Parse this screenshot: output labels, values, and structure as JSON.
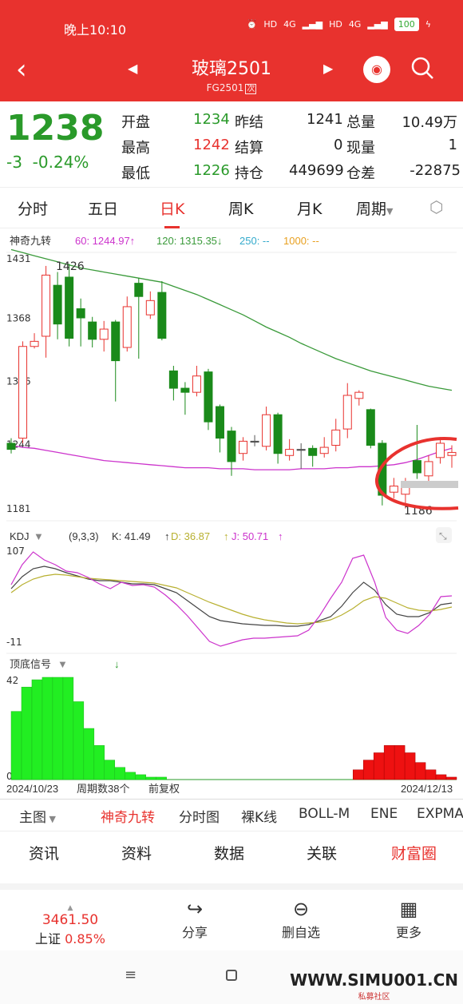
{
  "status": {
    "time": "晚上10:10",
    "battery": "100",
    "net1": "4G",
    "net2": "4G",
    "hd1": "HD",
    "hd2": "HD"
  },
  "nav": {
    "title": "玻璃2501",
    "subtitle": "FG2501",
    "subtitle_tag": "次"
  },
  "quote": {
    "price": "1238",
    "change": "-3",
    "change_pct": "-0.24%",
    "rows": [
      [
        {
          "label": "开盘",
          "value": "1234"
        },
        {
          "label": "昨结",
          "value": "1241"
        },
        {
          "label": "总量",
          "value": "10.49万"
        }
      ],
      [
        {
          "label": "最高",
          "value": "1242"
        },
        {
          "label": "结算",
          "value": "0"
        },
        {
          "label": "现量",
          "value": "1"
        }
      ],
      [
        {
          "label": "最低",
          "value": "1226"
        },
        {
          "label": "持仓",
          "value": "449699"
        },
        {
          "label": "仓差",
          "value": "-22875"
        }
      ]
    ]
  },
  "tabs": [
    "分时",
    "五日",
    "日K",
    "周K",
    "月K",
    "周期"
  ],
  "chart_data": [
    {
      "type": "candlestick",
      "indicator_name": "神奇九转",
      "ma": [
        {
          "label": "60: 1244.97↑",
          "color": "#cc33cc"
        },
        {
          "label": "120: 1315.35↓",
          "color": "#3a9a3a"
        },
        {
          "label": "250: --",
          "color": "#33aacc"
        },
        {
          "label": "1000: --",
          "color": "#e8a020"
        }
      ],
      "y_ticks": [
        "1431",
        "1368",
        "1306",
        "1244",
        "1181"
      ],
      "ylim": [
        1181,
        1431
      ],
      "annotations": [
        "1426",
        "1186"
      ],
      "candles": [
        {
          "o": 1250,
          "c": 1244,
          "h": 1255,
          "l": 1240
        },
        {
          "o": 1255,
          "c": 1345,
          "h": 1350,
          "l": 1250
        },
        {
          "o": 1345,
          "c": 1350,
          "h": 1358,
          "l": 1343
        },
        {
          "o": 1355,
          "c": 1415,
          "h": 1424,
          "l": 1334
        },
        {
          "o": 1405,
          "c": 1367,
          "h": 1418,
          "l": 1352
        },
        {
          "o": 1413,
          "c": 1353,
          "h": 1426,
          "l": 1345
        },
        {
          "o": 1382,
          "c": 1373,
          "h": 1392,
          "l": 1345
        },
        {
          "o": 1369,
          "c": 1352,
          "h": 1374,
          "l": 1344
        },
        {
          "o": 1352,
          "c": 1362,
          "h": 1370,
          "l": 1340
        },
        {
          "o": 1369,
          "c": 1331,
          "h": 1371,
          "l": 1291
        },
        {
          "o": 1344,
          "c": 1384,
          "h": 1394,
          "l": 1340
        },
        {
          "o": 1407,
          "c": 1394,
          "h": 1412,
          "l": 1333
        },
        {
          "o": 1376,
          "c": 1390,
          "h": 1399,
          "l": 1372
        },
        {
          "o": 1398,
          "c": 1353,
          "h": 1409,
          "l": 1351
        },
        {
          "o": 1321,
          "c": 1304,
          "h": 1326,
          "l": 1292
        },
        {
          "o": 1304,
          "c": 1300,
          "h": 1310,
          "l": 1278
        },
        {
          "o": 1300,
          "c": 1316,
          "h": 1326,
          "l": 1296
        },
        {
          "o": 1320,
          "c": 1271,
          "h": 1323,
          "l": 1263
        },
        {
          "o": 1286,
          "c": 1255,
          "h": 1288,
          "l": 1241
        },
        {
          "o": 1262,
          "c": 1232,
          "h": 1266,
          "l": 1218
        },
        {
          "o": 1240,
          "c": 1252,
          "h": 1256,
          "l": 1233
        },
        {
          "o": 1252,
          "c": 1252,
          "h": 1258,
          "l": 1247
        },
        {
          "o": 1247,
          "c": 1278,
          "h": 1286,
          "l": 1243
        },
        {
          "o": 1278,
          "c": 1240,
          "h": 1280,
          "l": 1230
        },
        {
          "o": 1238,
          "c": 1244,
          "h": 1254,
          "l": 1233
        },
        {
          "o": 1244,
          "c": 1244,
          "h": 1250,
          "l": 1225
        },
        {
          "o": 1245,
          "c": 1238,
          "h": 1248,
          "l": 1227
        },
        {
          "o": 1240,
          "c": 1246,
          "h": 1256,
          "l": 1236
        },
        {
          "o": 1248,
          "c": 1263,
          "h": 1274,
          "l": 1242
        },
        {
          "o": 1264,
          "c": 1297,
          "h": 1309,
          "l": 1255
        },
        {
          "o": 1294,
          "c": 1300,
          "h": 1302,
          "l": 1287
        },
        {
          "o": 1283,
          "c": 1248,
          "h": 1284,
          "l": 1245
        },
        {
          "o": 1250,
          "c": 1199,
          "h": 1253,
          "l": 1189
        },
        {
          "o": 1202,
          "c": 1208,
          "h": 1216,
          "l": 1196
        },
        {
          "o": 1200,
          "c": 1212,
          "h": 1216,
          "l": 1186
        },
        {
          "o": 1233,
          "c": 1221,
          "h": 1268,
          "l": 1215
        },
        {
          "o": 1218,
          "c": 1232,
          "h": 1238,
          "l": 1210
        },
        {
          "o": 1236,
          "c": 1250,
          "h": 1256,
          "l": 1230
        },
        {
          "o": 1238,
          "c": 1241,
          "h": 1248,
          "l": 1226
        }
      ],
      "ma60": [
        1248,
        1246,
        1245,
        1243,
        1241,
        1239,
        1237,
        1235,
        1233,
        1232,
        1231,
        1230,
        1229,
        1228,
        1227,
        1226,
        1226,
        1226,
        1225,
        1225,
        1225,
        1224,
        1224,
        1224,
        1224,
        1225,
        1225,
        1225,
        1226,
        1226,
        1227,
        1227,
        1228,
        1229,
        1231,
        1234,
        1238,
        1242,
        1245
      ],
      "ma120": [
        1440,
        1437,
        1434,
        1431,
        1428,
        1425,
        1422,
        1420,
        1418,
        1416,
        1414,
        1412,
        1410,
        1408,
        1404,
        1400,
        1396,
        1391,
        1386,
        1381,
        1376,
        1370,
        1364,
        1359,
        1354,
        1348,
        1343,
        1338,
        1333,
        1329,
        1325,
        1321,
        1318,
        1315,
        1312,
        1309,
        1306,
        1304,
        1302
      ]
    },
    {
      "type": "line",
      "indicator_name": "KDJ",
      "params": "(9,3,3)",
      "k_label": "K: 41.49",
      "d_label": "D: 36.87",
      "j_label": "J: 50.71",
      "y_ticks": [
        "107",
        "-11"
      ],
      "ylim": [
        -11,
        107
      ],
      "series": [
        {
          "name": "K",
          "color": "#444444",
          "values": [
            60,
            75,
            85,
            88,
            85,
            80,
            76,
            72,
            70,
            70,
            68,
            66,
            66,
            65,
            60,
            55,
            45,
            35,
            25,
            20,
            18,
            16,
            15,
            14,
            14,
            13,
            13,
            15,
            20,
            25,
            38,
            55,
            68,
            58,
            40,
            28,
            25,
            25,
            30,
            40,
            42
          ]
        },
        {
          "name": "D",
          "color": "#b8b030",
          "values": [
            55,
            65,
            72,
            76,
            78,
            77,
            75,
            73,
            72,
            71,
            70,
            69,
            68,
            67,
            64,
            61,
            55,
            49,
            43,
            38,
            33,
            28,
            24,
            21,
            19,
            17,
            16,
            17,
            18,
            21,
            27,
            35,
            45,
            50,
            48,
            42,
            36,
            33,
            32,
            34,
            37
          ]
        },
        {
          "name": "J",
          "color": "#cc33cc",
          "values": [
            65,
            90,
            106,
            96,
            90,
            82,
            80,
            74,
            66,
            60,
            68,
            64,
            65,
            62,
            52,
            40,
            26,
            10,
            -6,
            -12,
            -8,
            -4,
            -2,
            -2,
            -1,
            0,
            1,
            8,
            26,
            48,
            68,
            98,
            102,
            68,
            24,
            8,
            4,
            14,
            28,
            50,
            51
          ]
        }
      ]
    },
    {
      "type": "bar",
      "indicator_name": "顶底信号",
      "y_ticks": [
        "42",
        "0"
      ],
      "ylim": [
        0,
        42
      ],
      "x_labels": [
        "2024/10/23",
        "周期数38个",
        "前复权",
        "2024/12/13"
      ],
      "values": [
        28,
        38,
        41,
        42,
        42,
        42,
        32,
        21,
        14,
        8,
        5,
        3,
        2,
        1,
        1,
        0,
        0,
        0,
        0,
        0,
        0,
        0,
        0,
        0,
        0,
        0,
        0,
        0,
        0,
        0,
        0,
        0,
        0,
        -4,
        -8,
        -11,
        -14,
        -14,
        -11,
        -7,
        -4,
        -2,
        -1
      ]
    }
  ],
  "footer_tabs": [
    "主图",
    "神奇九转",
    "分时图",
    "裸K线",
    "BOLL-M",
    "ENE",
    "EXPMA"
  ],
  "bottom_tabs": [
    "资讯",
    "资料",
    "数据",
    "关联",
    "财富圈"
  ],
  "toolbar": {
    "index_value": "3461.50",
    "index_name": "上证",
    "index_pct": "0.85%",
    "share": "分享",
    "remove": "删自选",
    "more": "更多"
  },
  "watermark": {
    "text": "WWW.SIMU001.CN",
    "sub": "私募社区"
  }
}
